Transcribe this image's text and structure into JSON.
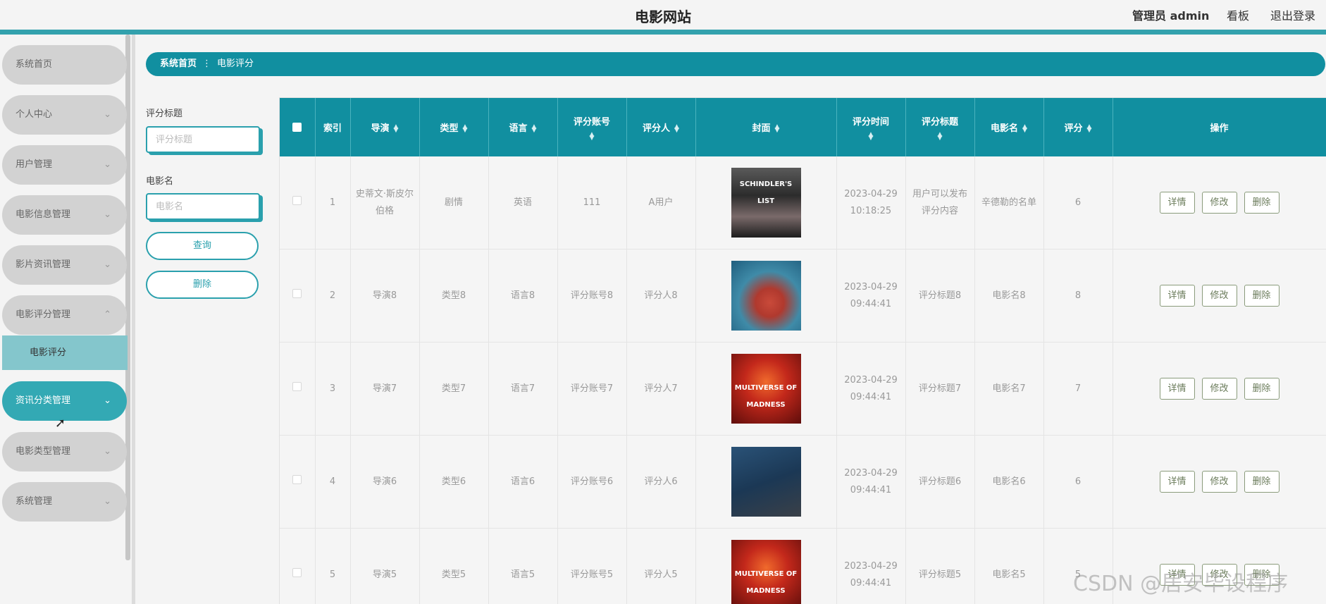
{
  "header": {
    "site_title": "电影网站",
    "admin_label": "管理员 admin",
    "board_label": "看板",
    "logout_label": "退出登录"
  },
  "sidebar": {
    "items": [
      {
        "label": "系统首页",
        "expandable": false
      },
      {
        "label": "个人中心",
        "expandable": true
      },
      {
        "label": "用户管理",
        "expandable": true
      },
      {
        "label": "电影信息管理",
        "expandable": true
      },
      {
        "label": "影片资讯管理",
        "expandable": true
      },
      {
        "label": "电影评分管理",
        "expandable": true,
        "expanded": true
      },
      {
        "label": "资讯分类管理",
        "expandable": true,
        "active": true
      },
      {
        "label": "电影类型管理",
        "expandable": true
      },
      {
        "label": "系统管理",
        "expandable": true
      }
    ],
    "submenu_label": "电影评分"
  },
  "breadcrumb": {
    "home": "系统首页",
    "separator": "⋮",
    "current": "电影评分"
  },
  "search": {
    "title_label": "评分标题",
    "title_placeholder": "评分标题",
    "movie_label": "电影名",
    "movie_placeholder": "电影名",
    "query_button": "查询",
    "delete_button": "删除"
  },
  "table": {
    "headers": [
      "索引",
      "导演",
      "类型",
      "语言",
      "评分账号",
      "评分人",
      "封面",
      "评分时间",
      "评分标题",
      "电影名",
      "评分",
      "操作"
    ],
    "rows": [
      {
        "index": "1",
        "director": "史蒂文·斯皮尔伯格",
        "type": "剧情",
        "language": "英语",
        "account": "111",
        "rater": "A用户",
        "cover": "schindlers-list-poster",
        "time": "2023-04-29 10:18:25",
        "title": "用户可以发布评分内容",
        "movie": "辛德勒的名单",
        "score": "6"
      },
      {
        "index": "2",
        "director": "导演8",
        "type": "类型8",
        "language": "语言8",
        "account": "评分账号8",
        "rater": "评分人8",
        "cover": "animated-poster",
        "time": "2023-04-29 09:44:41",
        "title": "评分标题8",
        "movie": "电影名8",
        "score": "8"
      },
      {
        "index": "3",
        "director": "导演7",
        "type": "类型7",
        "language": "语言7",
        "account": "评分账号7",
        "rater": "评分人7",
        "cover": "doctor-strange-poster",
        "time": "2023-04-29 09:44:41",
        "title": "评分标题7",
        "movie": "电影名7",
        "score": "7"
      },
      {
        "index": "4",
        "director": "导演6",
        "type": "类型6",
        "language": "语言6",
        "account": "评分账号6",
        "rater": "评分人6",
        "cover": "blue-portrait-poster",
        "time": "2023-04-29 09:44:41",
        "title": "评分标题6",
        "movie": "电影名6",
        "score": "6"
      },
      {
        "index": "5",
        "director": "导演5",
        "type": "类型5",
        "language": "语言5",
        "account": "评分账号5",
        "rater": "评分人5",
        "cover": "doctor-strange-poster",
        "time": "2023-04-29 09:44:41",
        "title": "评分标题5",
        "movie": "电影名5",
        "score": "5"
      }
    ],
    "actions": {
      "detail": "详情",
      "edit": "修改",
      "delete": "删除"
    }
  },
  "poster_text": {
    "schindler": "SCHINDLER'S LIST",
    "strange": "MULTIVERSE OF MADNESS"
  },
  "watermark": "CSDN @居安毕设程序",
  "colors": {
    "accent": "#118fa0",
    "active_menu": "#33a9b4",
    "submenu": "#84c6cc"
  }
}
